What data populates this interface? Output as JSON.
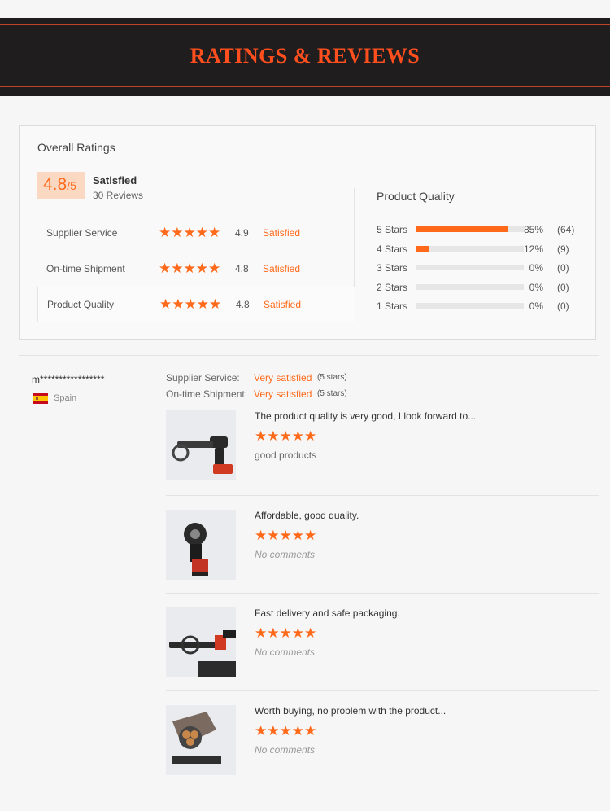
{
  "banner": {
    "title": "RATINGS & REVIEWS"
  },
  "overall": {
    "title": "Overall Ratings",
    "score": "4.8",
    "score_denominator": "/5",
    "status": "Satisfied",
    "reviews": "30 Reviews",
    "rows": [
      {
        "label": "Supplier Service",
        "stars": "★★★★★",
        "value": "4.9",
        "status": "Satisfied"
      },
      {
        "label": "On-time Shipment",
        "stars": "★★★★★",
        "value": "4.8",
        "status": "Satisfied"
      },
      {
        "label": "Product Quality",
        "stars": "★★★★★",
        "value": "4.8",
        "status": "Satisfied"
      }
    ]
  },
  "product_quality": {
    "title": "Product Quality",
    "rows": [
      {
        "label": "5  Stars",
        "fraction": 0.85,
        "pct": "85%",
        "count": "(64)"
      },
      {
        "label": "4  Stars",
        "fraction": 0.12,
        "pct": "12%",
        "count": "(9)"
      },
      {
        "label": "3  Stars",
        "fraction": 0,
        "pct": "0%",
        "count": "(0)"
      },
      {
        "label": "2  Stars",
        "fraction": 0,
        "pct": "0%",
        "count": "(0)"
      },
      {
        "label": "1  Stars",
        "fraction": 0,
        "pct": "0%",
        "count": "(0)"
      }
    ]
  },
  "review": {
    "user": "m*****************",
    "country": "Spain",
    "meta": [
      {
        "key": "Supplier Service:",
        "value": "Very satisfied",
        "stars": "(5 stars)"
      },
      {
        "key": "On-time Shipment:",
        "value": "Very satisfied",
        "stars": "(5 stars)"
      }
    ],
    "items": [
      {
        "text": "The product quality is very good, I look forward to...",
        "stars": "★★★★★",
        "comment": "good products"
      },
      {
        "text": "Affordable, good quality.",
        "stars": "★★★★★",
        "comment": "No comments"
      },
      {
        "text": "Fast delivery and safe packaging.",
        "stars": "★★★★★",
        "comment": "No comments"
      },
      {
        "text": "Worth buying, no problem with the product...",
        "stars": "★★★★★",
        "comment": "No comments"
      }
    ]
  },
  "colors": {
    "accent": "#ff6a1a",
    "banner_bg": "#1f1d1d",
    "banner_title": "#ff4f1f"
  }
}
